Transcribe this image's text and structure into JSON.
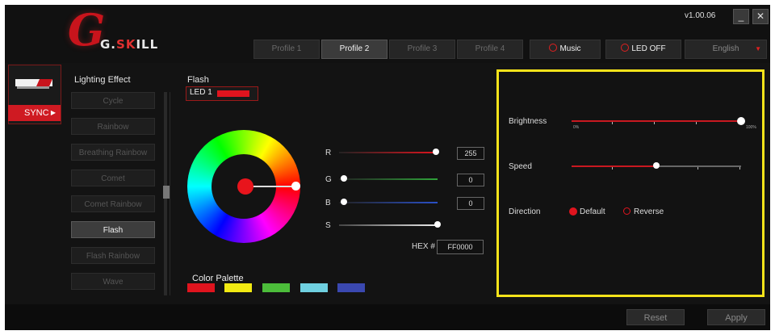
{
  "app": {
    "brand_mark": "G",
    "brand_g": "G.",
    "brand_sk": "SK",
    "brand_ill": "ILL",
    "version": "v1.00.06",
    "minimize_symbol": "_",
    "close_symbol": "✕",
    "accent_color": "#e0141e",
    "highlight_color": "#f6e31a"
  },
  "tabs": [
    {
      "label": "Profile 1",
      "active": false
    },
    {
      "label": "Profile 2",
      "active": true
    },
    {
      "label": "Profile 3",
      "active": false
    },
    {
      "label": "Profile 4",
      "active": false
    }
  ],
  "toolbar": {
    "music_label": "Music",
    "led_off_label": "LED OFF",
    "language": "English"
  },
  "device": {
    "sync_label": "SYNC"
  },
  "lighting": {
    "title": "Lighting Effect",
    "effects": [
      "Cycle",
      "Rainbow",
      "Breathing Rainbow",
      "Comet",
      "Comet Rainbow",
      "Flash",
      "Flash Rainbow",
      "Wave"
    ],
    "selected": "Flash"
  },
  "flash": {
    "title": "Flash",
    "led_label": "LED 1",
    "led_color": "#e0141e"
  },
  "color": {
    "r_label": "R",
    "g_label": "G",
    "b_label": "B",
    "s_label": "S",
    "r_value": "255",
    "g_value": "0",
    "b_value": "0",
    "s_level": 1.0,
    "hex_label": "HEX #",
    "hex_value": "FF0000"
  },
  "palette": {
    "title": "Color Palette",
    "colors": [
      "#e0141e",
      "#f2ea12",
      "#4cbd3a",
      "#6fd0e0",
      "#3a48b0"
    ]
  },
  "settings": {
    "brightness_label": "Brightness",
    "brightness_min": "0%",
    "brightness_max": "100%",
    "brightness_level": 1.0,
    "speed_label": "Speed",
    "speed_level": 0.5,
    "direction_label": "Direction",
    "direction_default": "Default",
    "direction_reverse": "Reverse",
    "direction_selected": "Default"
  },
  "footer": {
    "reset_label": "Reset",
    "apply_label": "Apply"
  }
}
